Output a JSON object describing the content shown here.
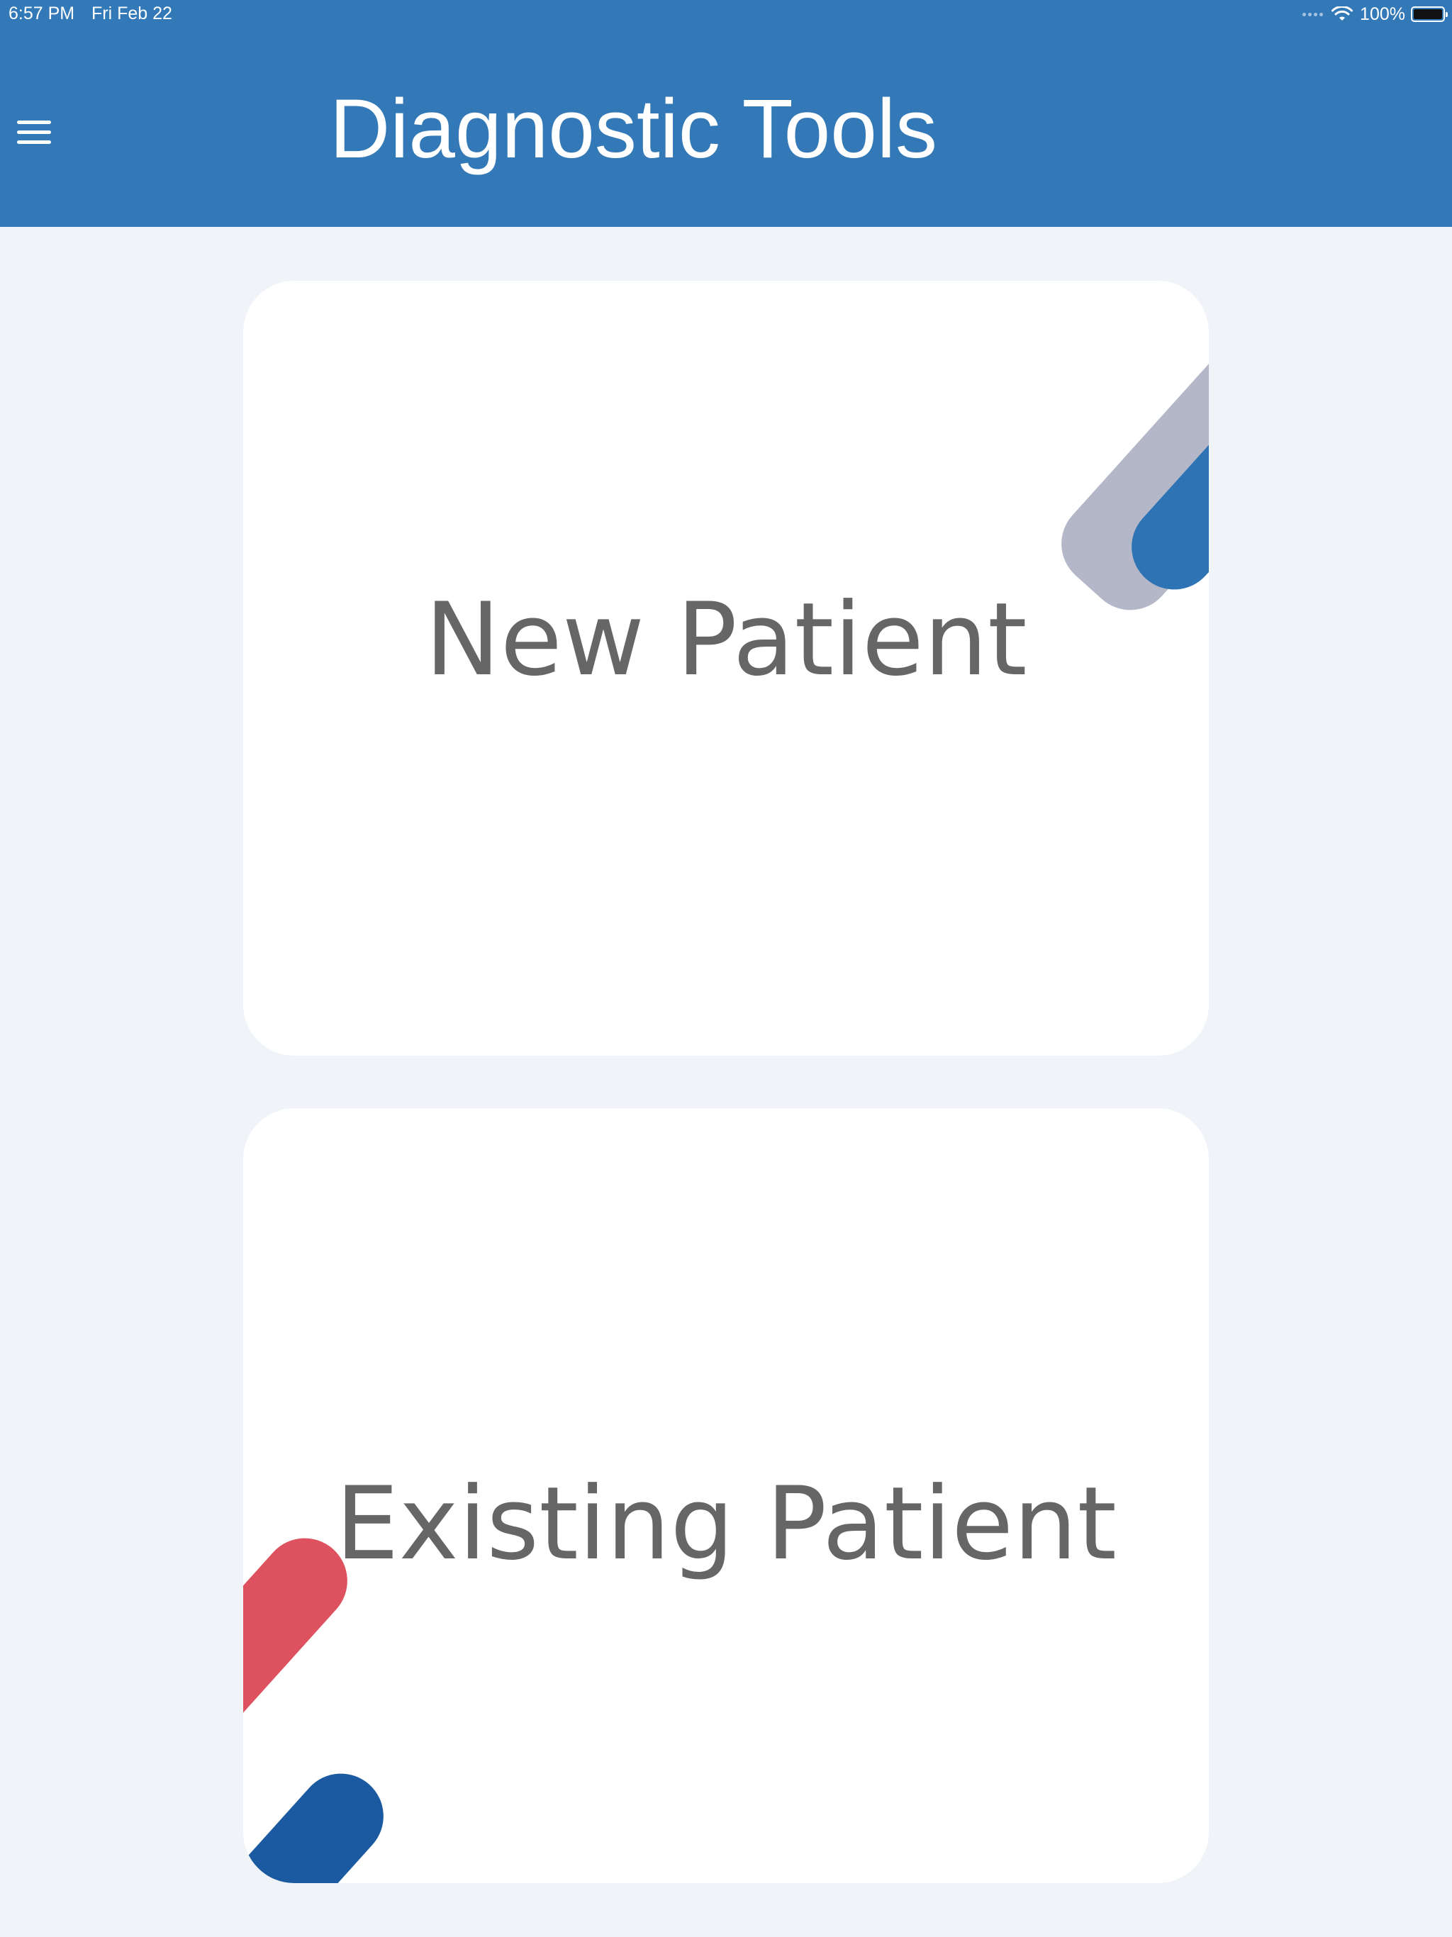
{
  "status_bar": {
    "time": "6:57 PM",
    "date": "Fri Feb 22",
    "battery": "100%"
  },
  "header": {
    "title": "Diagnostic Tools",
    "menu_icon": "hamburger-menu-icon"
  },
  "cards": {
    "new_patient": "New Patient",
    "existing_patient": "Existing Patient"
  },
  "colors": {
    "header_bg": "#3379b8",
    "page_bg": "#f0f3f8",
    "card_bg": "#ffffff",
    "label_text": "#666666",
    "accent_gray": "#b3b7c8",
    "accent_blue": "#2e74b4",
    "accent_red": "#de515e",
    "accent_darkblue": "#1b5aa0"
  }
}
